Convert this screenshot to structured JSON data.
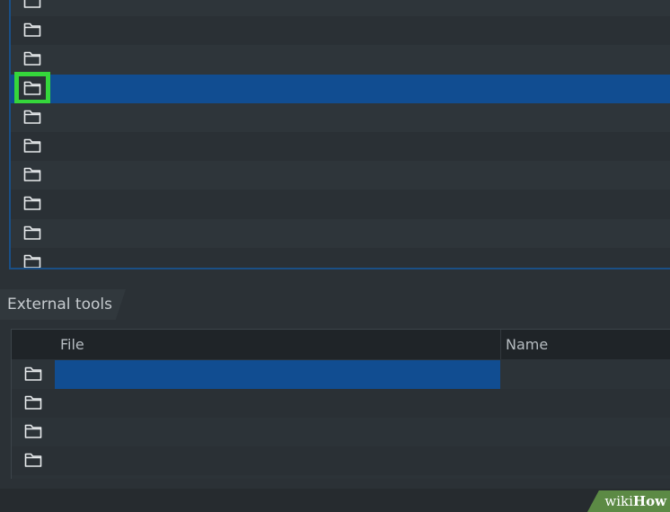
{
  "top_list": {
    "rows": [
      {
        "icon": "folder-icon",
        "selected": false
      },
      {
        "icon": "folder-icon",
        "selected": false
      },
      {
        "icon": "folder-icon",
        "selected": false
      },
      {
        "icon": "folder-icon",
        "selected": true,
        "highlighted": true
      },
      {
        "icon": "folder-icon",
        "selected": false
      },
      {
        "icon": "folder-icon",
        "selected": false
      },
      {
        "icon": "folder-icon",
        "selected": false
      },
      {
        "icon": "folder-icon",
        "selected": false
      },
      {
        "icon": "folder-icon",
        "selected": false
      },
      {
        "icon": "folder-icon",
        "selected": false
      }
    ]
  },
  "external_tools": {
    "tab_label": "External tools",
    "columns": {
      "file": "File",
      "name": "Name"
    },
    "rows": [
      {
        "icon": "folder-icon",
        "selected": true
      },
      {
        "icon": "folder-icon",
        "selected": false
      },
      {
        "icon": "folder-icon",
        "selected": false
      },
      {
        "icon": "folder-icon",
        "selected": false
      }
    ]
  },
  "watermark": {
    "prefix": "wiki",
    "suffix": "How"
  },
  "colors": {
    "selection": "#114d91",
    "highlight_box": "#35d63b",
    "panel_border": "#1a4f86",
    "watermark_bg": "#5c8a45"
  }
}
